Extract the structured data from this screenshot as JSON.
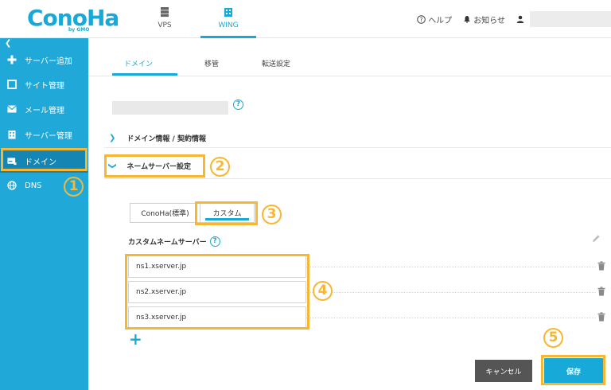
{
  "header": {
    "logo_text": "ConoHa",
    "logo_sub": "by GMO",
    "nav": [
      {
        "label": "VPS",
        "icon": "server-icon"
      },
      {
        "label": "WING",
        "icon": "building-icon"
      }
    ],
    "help_label": "ヘルプ",
    "notice_label": "お知らせ"
  },
  "sidebar": {
    "collapse_icon": "chevron-left-icon",
    "items": [
      {
        "label": "サーバー追加",
        "icon": "plus-icon"
      },
      {
        "label": "サイト管理",
        "icon": "window-icon"
      },
      {
        "label": "メール管理",
        "icon": "mail-icon"
      },
      {
        "label": "サーバー管理",
        "icon": "building-icon"
      },
      {
        "label": "ドメイン",
        "icon": "domain-card-icon"
      },
      {
        "label": "DNS",
        "icon": "globe-icon"
      }
    ]
  },
  "tabs": {
    "domain": "ドメイン",
    "transfer": "移管",
    "forward": "転送設定"
  },
  "sections": {
    "info": "ドメイン情報 / 契約情報",
    "nameserver": "ネームサーバー設定"
  },
  "ns_mode": {
    "standard": "ConoHa(標準)",
    "custom": "カスタム"
  },
  "custom_ns": {
    "label": "カスタムネームサーバー",
    "servers": [
      "ns1.xserver.jp",
      "ns2.xserver.jp",
      "ns3.xserver.jp"
    ]
  },
  "buttons": {
    "cancel": "キャンセル",
    "save": "保存"
  },
  "annotations": {
    "steps": [
      "1",
      "2",
      "3",
      "4",
      "5"
    ],
    "color": "#f7b733"
  },
  "colors": {
    "accent": "#17a9d8",
    "sidebar": "#1fa8d8",
    "sidebar_active": "#1586b3"
  }
}
